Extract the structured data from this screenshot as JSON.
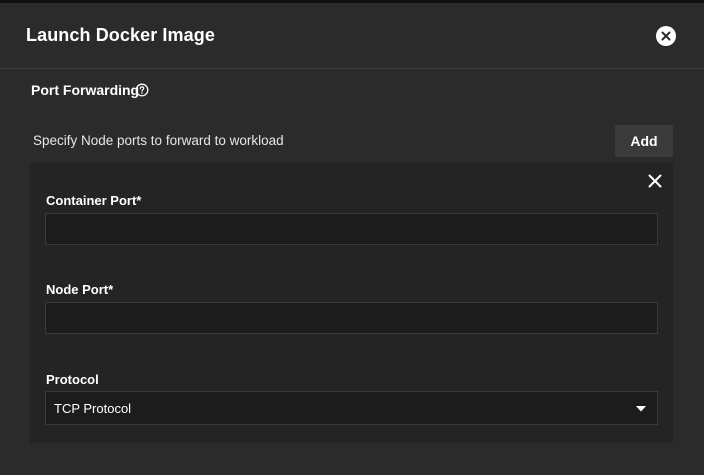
{
  "dialog": {
    "title": "Launch Docker Image",
    "close_icon": "close-circle-icon"
  },
  "port_forwarding": {
    "section_title": "Port Forwarding",
    "help_icon": "help-circle-icon",
    "description": "Specify Node ports to forward to workload",
    "add_label": "Add",
    "items": [
      {
        "remove_icon": "close-icon",
        "container_port": {
          "label": "Container Port*",
          "value": ""
        },
        "node_port": {
          "label": "Node Port*",
          "value": ""
        },
        "protocol": {
          "label": "Protocol",
          "selected": "TCP Protocol",
          "dropdown_icon": "caret-down-icon"
        }
      }
    ]
  },
  "colors": {
    "background": "#2b2b2b",
    "card": "#242424",
    "input": "#1c1c1c",
    "button": "#3a3a3a"
  }
}
